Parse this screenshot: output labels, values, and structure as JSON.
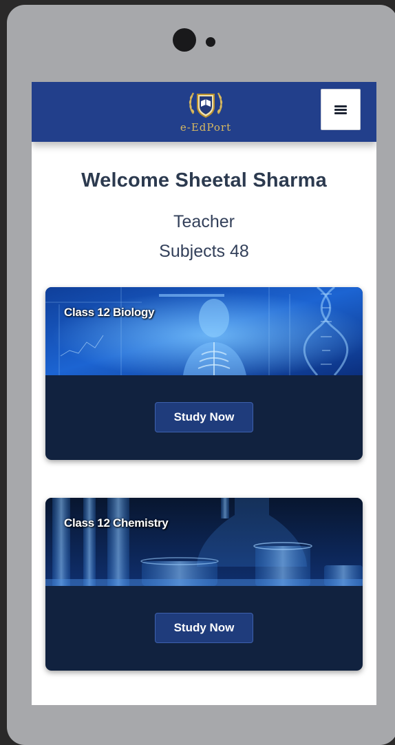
{
  "header": {
    "logo_text": "e-EdPort",
    "menu_icon": "hamburger-menu-icon"
  },
  "welcome": {
    "greeting": "Welcome Sheetal Sharma",
    "role": "Teacher",
    "subjects_count": "Subjects 48"
  },
  "cards": [
    {
      "title": "Class 12 Biology",
      "button_label": "Study Now",
      "image": "biology-banner"
    },
    {
      "title": "Class 12 Chemistry",
      "button_label": "Study Now",
      "image": "chemistry-banner"
    }
  ],
  "colors": {
    "navbar": "#223f8b",
    "card_body": "#11223f",
    "button": "#1f3c7c",
    "logo_gold": "#d8b961",
    "device_frame": "#a7a8ab"
  }
}
